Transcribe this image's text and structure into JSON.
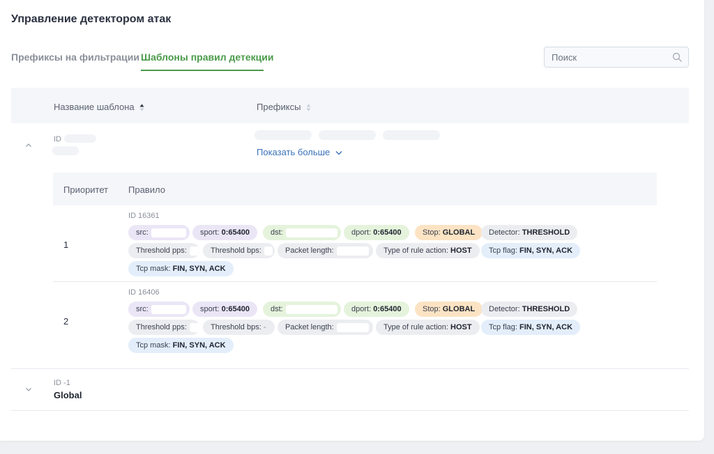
{
  "page": {
    "title": "Управление детектором атак"
  },
  "tabs": [
    {
      "label": "Префиксы на фильтрации",
      "active": false
    },
    {
      "label": "Шаблоны правил детекции",
      "active": true
    }
  ],
  "search": {
    "placeholder": "Поиск",
    "value": ""
  },
  "table": {
    "columns": {
      "name": "Название шаблона",
      "prefixes": "Префиксы"
    },
    "rows": [
      {
        "id_label": "ID",
        "expanded": true,
        "show_more": "Показать больше",
        "rules_table": {
          "columns": {
            "priority": "Приоритет",
            "rule": "Правило"
          },
          "rules": [
            {
              "priority": "1",
              "id_label": "ID 16361",
              "tags": {
                "src": "src:",
                "sport_k": "sport:",
                "sport_v": "0:65400",
                "dst": "dst:",
                "dport_k": "dport:",
                "dport_v": "0:65400",
                "stop_k": "Stop:",
                "stop_v": "GLOBAL",
                "detector_k": "Detector:",
                "detector_v": "THRESHOLD",
                "pps": "Threshold pps:",
                "bps": "Threshold bps:",
                "pktlen": "Packet length:",
                "action_k": "Type of rule action:",
                "action_v": "HOST",
                "tcpflag_k": "Tcp flag:",
                "tcpflag_v": "FIN, SYN, ACK",
                "tcpmask_k": "Tcp mask:",
                "tcpmask_v": "FIN, SYN, ACK"
              }
            },
            {
              "priority": "2",
              "id_label": "ID 16406",
              "tags": {
                "src": "src:",
                "sport_k": "sport:",
                "sport_v": "0:65400",
                "dst": "dst:",
                "dport_k": "dport:",
                "dport_v": "0:65400",
                "stop_k": "Stop:",
                "stop_v": "GLOBAL",
                "detector_k": "Detector:",
                "detector_v": "THRESHOLD",
                "pps": "Threshold pps:",
                "bps": "Threshold bps:",
                "bps_v": "-",
                "pktlen": "Packet length:",
                "action_k": "Type of rule action:",
                "action_v": "HOST",
                "tcpflag_k": "Tcp flag:",
                "tcpflag_v": "FIN, SYN, ACK",
                "tcpmask_k": "Tcp mask:",
                "tcpmask_v": "FIN, SYN, ACK"
              }
            }
          ]
        }
      },
      {
        "id_label": "ID -1",
        "name": "Global",
        "expanded": false
      }
    ]
  },
  "colors": {
    "accent_green": "#4a9a4a",
    "link_blue": "#3a72b8",
    "tag_purple": "#ebe6f6",
    "tag_green": "#e5f3dc",
    "tag_orange": "#fbe3c3",
    "tag_gray": "#ecedf0",
    "tag_blue": "#e3eefa"
  }
}
